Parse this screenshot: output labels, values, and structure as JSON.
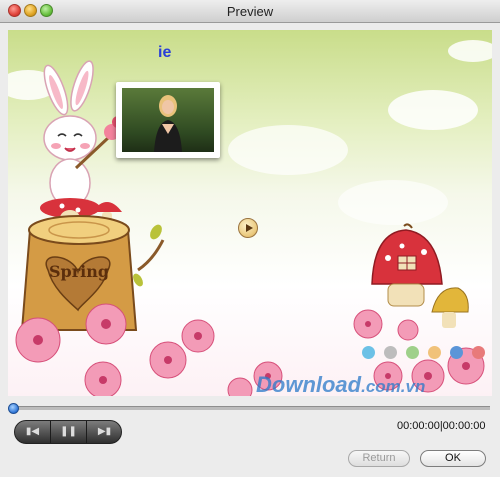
{
  "window": {
    "title": "Preview"
  },
  "preview": {
    "overlay_text": "ie",
    "watermark": {
      "main": "Download",
      "tld": ".com.vn"
    },
    "play_icon": "play-icon",
    "spring_sign": "Spring"
  },
  "color_dots": [
    "#6cc1e6",
    "#bdbdbd",
    "#9fd08a",
    "#f1c27a",
    "#5b95d8",
    "#e87a7a"
  ],
  "player": {
    "progress": 0.0,
    "time": "00:00:00|00:00:00",
    "controls": {
      "prev_icon": "prev-icon",
      "pause_icon": "pause-icon",
      "next_icon": "next-icon"
    }
  },
  "buttons": {
    "return_label": "Return",
    "ok_label": "OK"
  },
  "colors": {
    "accent": "#2d74d6",
    "watermark": "#2878c8"
  }
}
